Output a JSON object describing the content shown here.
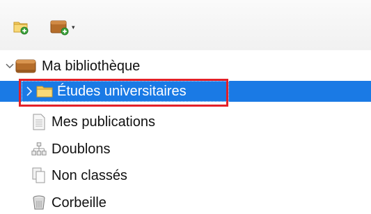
{
  "toolbar": {
    "new_collection_icon": "new-collection-icon",
    "new_library_icon": "new-library-icon",
    "dropdown_glyph": "▾"
  },
  "tree": {
    "root": {
      "label": "Ma bibliothèque",
      "icon": "library-icon",
      "expanded": true
    },
    "selected": {
      "label": "Études universitaires",
      "icon": "folder-icon",
      "expanded": false
    },
    "items": [
      {
        "label": "Mes publications",
        "icon": "document-icon"
      },
      {
        "label": "Doublons",
        "icon": "duplicates-icon"
      },
      {
        "label": "Non classés",
        "icon": "unfiled-icon"
      },
      {
        "label": "Corbeille",
        "icon": "trash-icon"
      }
    ]
  },
  "colors": {
    "selection": "#1a7ae5",
    "highlight_border": "#e32028",
    "library_brown": "#b56d2a",
    "folder_yellow": "#f2c14e"
  }
}
